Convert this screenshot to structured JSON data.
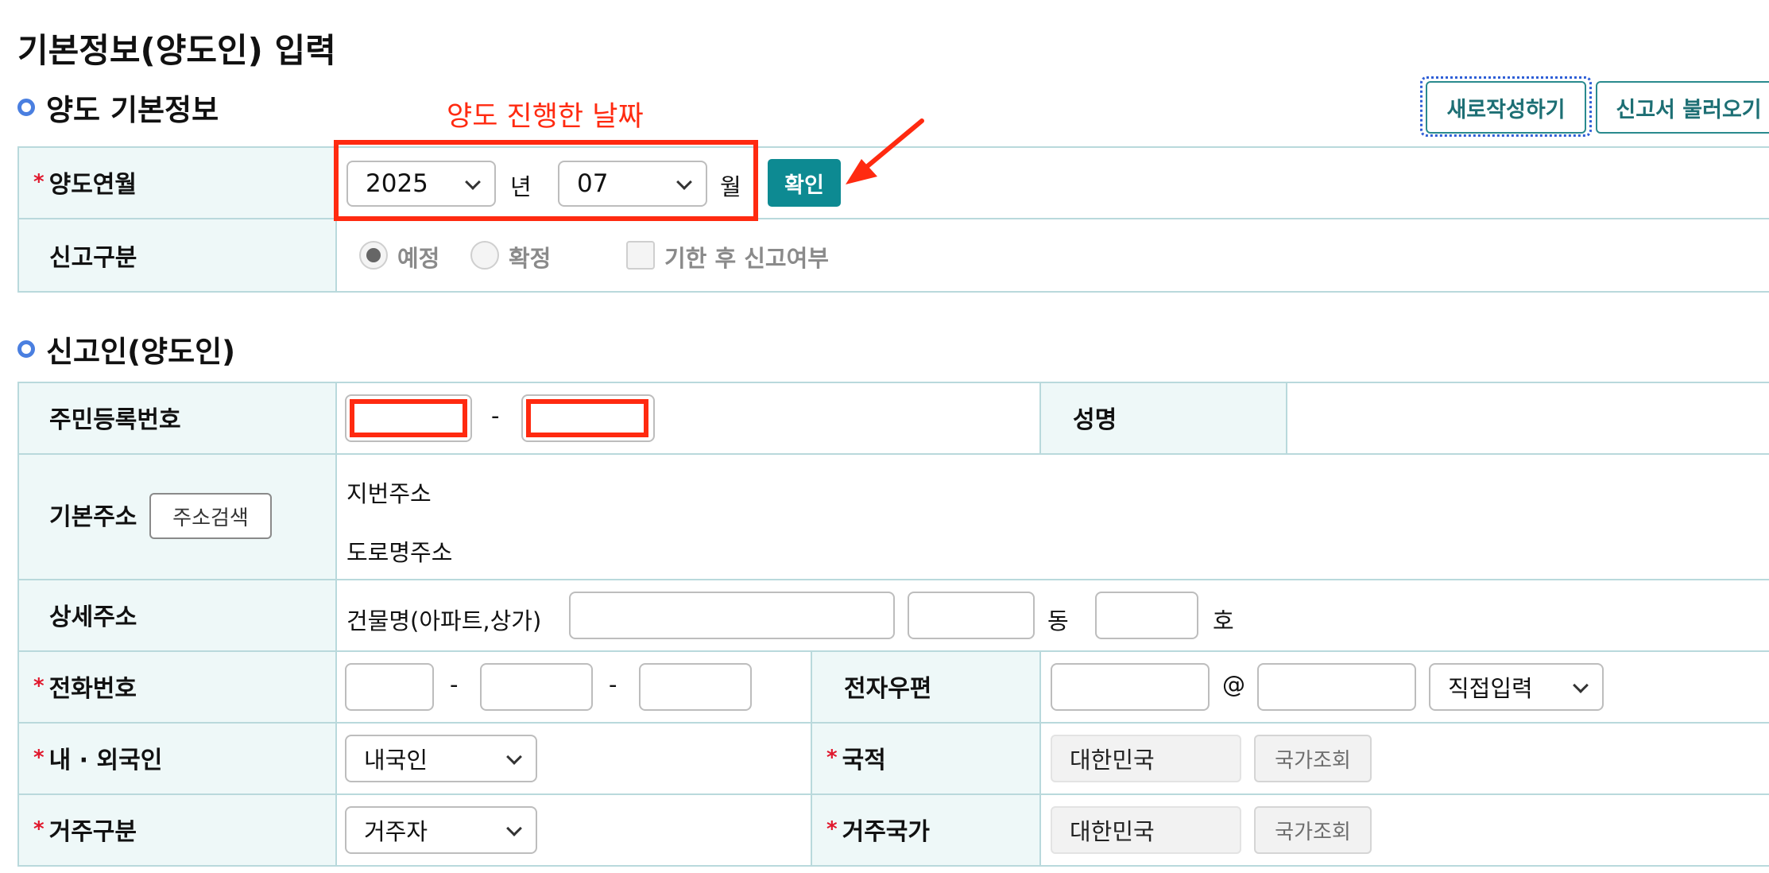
{
  "page_title": "기본정보(양도인) 입력",
  "section_basic": {
    "title": "양도 기본정보",
    "annotation": "양도 진행한 날짜",
    "buttons": {
      "new": "새로작성하기",
      "load": "신고서 불러오기"
    },
    "transfer_ym": {
      "label": "양도연월",
      "year": "2025",
      "year_unit": "년",
      "month": "07",
      "month_unit": "월",
      "confirm": "확인"
    },
    "report_type": {
      "label": "신고구분",
      "options": [
        "예정",
        "확정"
      ],
      "selected": "예정",
      "late_label": "기한 후 신고여부"
    }
  },
  "section_reporter": {
    "title": "신고인(양도인)",
    "rrn": {
      "label": "주민등록번호",
      "separator": "-"
    },
    "name": {
      "label": "성명"
    },
    "address": {
      "label": "기본주소",
      "search_button": "주소검색",
      "jibun": "지번주소",
      "road": "도로명주소"
    },
    "detail": {
      "label": "상세주소",
      "building": "건물명(아파트,상가)",
      "dong": "동",
      "ho": "호"
    },
    "phone": {
      "label": "전화번호",
      "separator": "-"
    },
    "email": {
      "label": "전자우편",
      "at": "@",
      "domain_select": "직접입력"
    },
    "nationality_type": {
      "label": "내 · 외국인",
      "value": "내국인"
    },
    "nationality": {
      "label": "국적",
      "value": "대한민국",
      "lookup": "국가조회"
    },
    "residence_type": {
      "label": "거주구분",
      "value": "거주자"
    },
    "residence_country": {
      "label": "거주국가",
      "value": "대한민국",
      "lookup": "국가조회"
    }
  },
  "colors": {
    "accent": "#0d8a92",
    "annotation_red": "#ff2a10",
    "required_star": "#e0182d",
    "label_bg": "#eef8f8"
  },
  "icons": [
    "section-dot-icon",
    "chevron-down-icon",
    "arrow-icon",
    "required-star-icon"
  ]
}
